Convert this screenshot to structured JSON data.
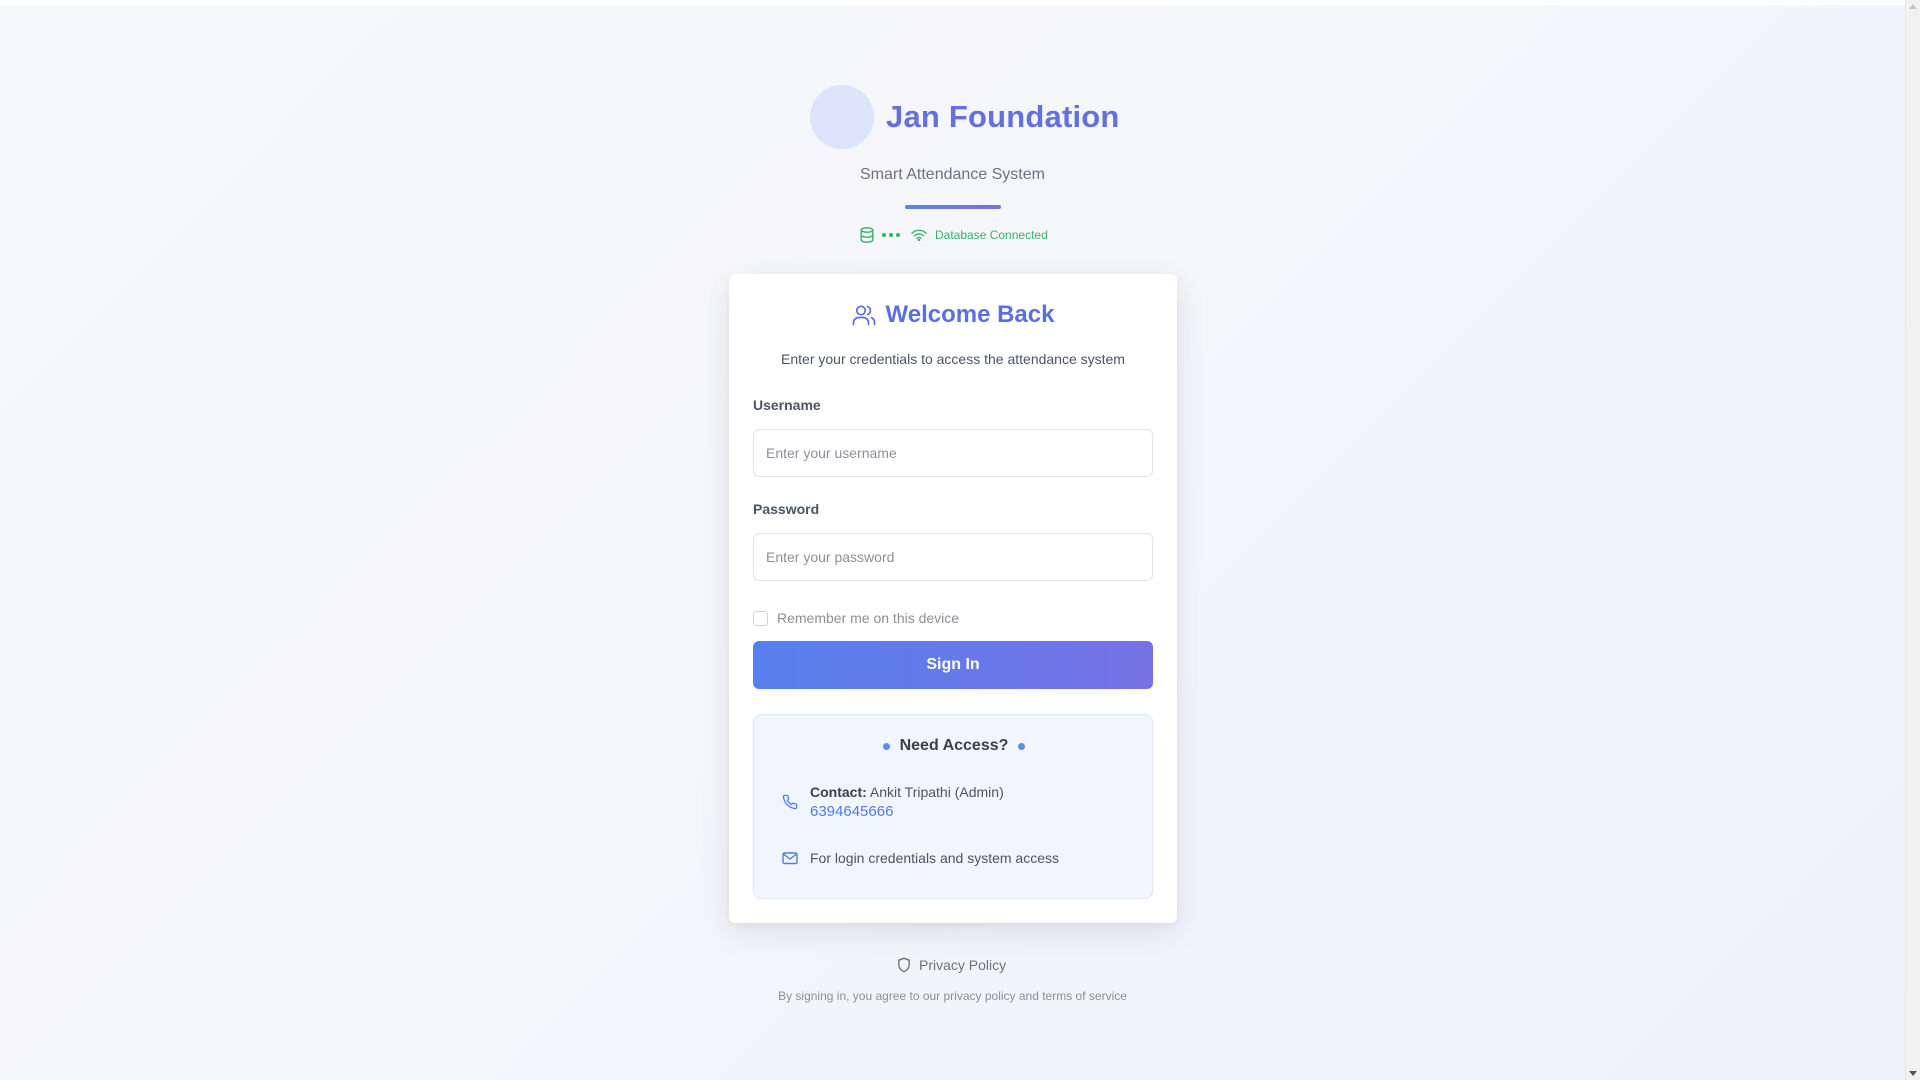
{
  "brand": {
    "title": "Jan Foundation",
    "subtitle": "Smart Attendance System",
    "logo_icon": "logo-circle",
    "accent_color": "#6270e0"
  },
  "status": {
    "text": "Database Connected",
    "color": "#34b36b",
    "icons": [
      "database-icon",
      "wifi-icon"
    ]
  },
  "card": {
    "title": "Welcome Back",
    "title_icon": "users-icon",
    "description": "Enter your credentials to access the attendance system",
    "username": {
      "label": "Username",
      "placeholder": "Enter your username",
      "value": ""
    },
    "password": {
      "label": "Password",
      "placeholder": "Enter your password",
      "value": ""
    },
    "remember_label": "Remember me on this device",
    "remember_checked": false,
    "signin_label": "Sign In",
    "signin_gradient": [
      "#5680ec",
      "#7672e4"
    ]
  },
  "access": {
    "title": "Need Access?",
    "contact_label": "Contact:",
    "contact_name": "Ankit Tripathi (Admin)",
    "phone": "6394645666",
    "mail_text": "For login credentials and system access",
    "icons": [
      "phone-icon",
      "mail-icon"
    ]
  },
  "footer": {
    "privacy_label": "Privacy Policy",
    "privacy_icon": "shield-icon",
    "terms_text": "By signing in, you agree to our privacy policy and terms of service"
  }
}
